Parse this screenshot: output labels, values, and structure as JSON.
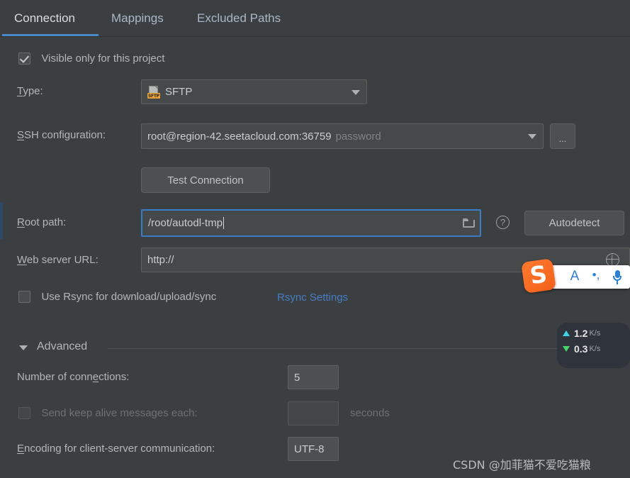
{
  "tabs": [
    {
      "label": "Connection",
      "active": true
    },
    {
      "label": "Mappings",
      "active": false
    },
    {
      "label": "Excluded Paths",
      "active": false
    }
  ],
  "visible_only": {
    "label": "Visible only for this project",
    "checked": "true"
  },
  "type_row": {
    "label_pre": "T",
    "label_mnemonic": "T",
    "label": "ype:",
    "full_label": "Type:",
    "value": "SFTP",
    "icon": "sftp-file-icon",
    "badge": "SFTP"
  },
  "ssh_row": {
    "full_label": "SSH configuration:",
    "value": "root@region-42.seetacloud.com:36759",
    "hint": "password",
    "browse_button": "..."
  },
  "test_connection": {
    "label": "Test Connection"
  },
  "root_path": {
    "full_label": "Root path:",
    "value": "/root/autodl-tmp",
    "folder_icon": "folder-icon",
    "help_icon": "help-question-icon",
    "autodetect_label": "Autodetect"
  },
  "web_server": {
    "full_label": "Web server URL:",
    "value": "http://",
    "globe_icon": "globe-icon"
  },
  "rsync": {
    "checkbox_label": "Use Rsync for download/upload/sync",
    "checked": "false",
    "settings_link": "Rsync Settings"
  },
  "advanced": {
    "title": "Advanced",
    "collapse_icon": "triangle-down-icon",
    "connections": {
      "label": "Number of connections:",
      "value": "5"
    },
    "keep_alive": {
      "label": "Send keep alive messages each:",
      "value": "",
      "unit": "seconds",
      "checked": "false",
      "disabled": "true"
    },
    "encoding": {
      "label": "Encoding for client-server communication:",
      "value": "UTF-8"
    }
  },
  "ime_bar": {
    "logo": "S",
    "mode": "A",
    "punctuation": "•,",
    "mic_icon": "microphone-icon"
  },
  "network_speed": {
    "upload_value": "1.2",
    "upload_unit": "K/s",
    "download_value": "0.3",
    "download_unit": "K/s"
  },
  "watermark": {
    "text": "CSDN @加菲猫不爱吃猫粮"
  },
  "colors": {
    "background": "#3c3f41",
    "accent_blue": "#4a88c7",
    "link_blue": "#467ec4",
    "focus_blue": "#3c7cc4",
    "sftp_badge": "#e8a13a",
    "upload_arrow": "#3fd3e8",
    "download_arrow": "#4ad36a"
  }
}
